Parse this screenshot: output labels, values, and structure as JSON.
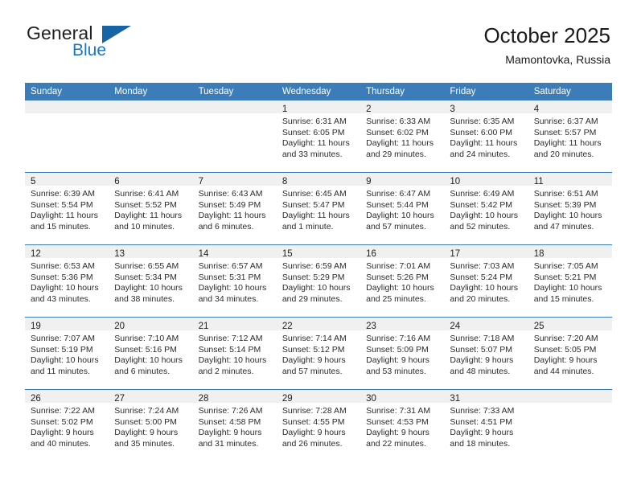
{
  "brand": {
    "name_part1": "General",
    "name_part2": "Blue",
    "flag_icon": "triangle-flag-icon",
    "accent_color": "#1878c8",
    "flag_color": "#1565a6"
  },
  "header": {
    "title": "October 2025",
    "subtitle": "Mamontovka, Russia"
  },
  "theme": {
    "header_row_bg": "#3c7cb8",
    "daynum_bar_bg": "#f0f0f0",
    "grid_line": "#3c7cb8",
    "text": "#2b2b2b"
  },
  "weekday_headers": [
    "Sunday",
    "Monday",
    "Tuesday",
    "Wednesday",
    "Thursday",
    "Friday",
    "Saturday"
  ],
  "weeks": [
    [
      {
        "empty": true,
        "day": "",
        "sunrise": "",
        "sunset": "",
        "daylight_line1": "",
        "daylight_line2": ""
      },
      {
        "empty": true,
        "day": "",
        "sunrise": "",
        "sunset": "",
        "daylight_line1": "",
        "daylight_line2": ""
      },
      {
        "empty": true,
        "day": "",
        "sunrise": "",
        "sunset": "",
        "daylight_line1": "",
        "daylight_line2": ""
      },
      {
        "empty": false,
        "day": "1",
        "sunrise": "Sunrise: 6:31 AM",
        "sunset": "Sunset: 6:05 PM",
        "daylight_line1": "Daylight: 11 hours",
        "daylight_line2": "and 33 minutes."
      },
      {
        "empty": false,
        "day": "2",
        "sunrise": "Sunrise: 6:33 AM",
        "sunset": "Sunset: 6:02 PM",
        "daylight_line1": "Daylight: 11 hours",
        "daylight_line2": "and 29 minutes."
      },
      {
        "empty": false,
        "day": "3",
        "sunrise": "Sunrise: 6:35 AM",
        "sunset": "Sunset: 6:00 PM",
        "daylight_line1": "Daylight: 11 hours",
        "daylight_line2": "and 24 minutes."
      },
      {
        "empty": false,
        "day": "4",
        "sunrise": "Sunrise: 6:37 AM",
        "sunset": "Sunset: 5:57 PM",
        "daylight_line1": "Daylight: 11 hours",
        "daylight_line2": "and 20 minutes."
      }
    ],
    [
      {
        "empty": false,
        "day": "5",
        "sunrise": "Sunrise: 6:39 AM",
        "sunset": "Sunset: 5:54 PM",
        "daylight_line1": "Daylight: 11 hours",
        "daylight_line2": "and 15 minutes."
      },
      {
        "empty": false,
        "day": "6",
        "sunrise": "Sunrise: 6:41 AM",
        "sunset": "Sunset: 5:52 PM",
        "daylight_line1": "Daylight: 11 hours",
        "daylight_line2": "and 10 minutes."
      },
      {
        "empty": false,
        "day": "7",
        "sunrise": "Sunrise: 6:43 AM",
        "sunset": "Sunset: 5:49 PM",
        "daylight_line1": "Daylight: 11 hours",
        "daylight_line2": "and 6 minutes."
      },
      {
        "empty": false,
        "day": "8",
        "sunrise": "Sunrise: 6:45 AM",
        "sunset": "Sunset: 5:47 PM",
        "daylight_line1": "Daylight: 11 hours",
        "daylight_line2": "and 1 minute."
      },
      {
        "empty": false,
        "day": "9",
        "sunrise": "Sunrise: 6:47 AM",
        "sunset": "Sunset: 5:44 PM",
        "daylight_line1": "Daylight: 10 hours",
        "daylight_line2": "and 57 minutes."
      },
      {
        "empty": false,
        "day": "10",
        "sunrise": "Sunrise: 6:49 AM",
        "sunset": "Sunset: 5:42 PM",
        "daylight_line1": "Daylight: 10 hours",
        "daylight_line2": "and 52 minutes."
      },
      {
        "empty": false,
        "day": "11",
        "sunrise": "Sunrise: 6:51 AM",
        "sunset": "Sunset: 5:39 PM",
        "daylight_line1": "Daylight: 10 hours",
        "daylight_line2": "and 47 minutes."
      }
    ],
    [
      {
        "empty": false,
        "day": "12",
        "sunrise": "Sunrise: 6:53 AM",
        "sunset": "Sunset: 5:36 PM",
        "daylight_line1": "Daylight: 10 hours",
        "daylight_line2": "and 43 minutes."
      },
      {
        "empty": false,
        "day": "13",
        "sunrise": "Sunrise: 6:55 AM",
        "sunset": "Sunset: 5:34 PM",
        "daylight_line1": "Daylight: 10 hours",
        "daylight_line2": "and 38 minutes."
      },
      {
        "empty": false,
        "day": "14",
        "sunrise": "Sunrise: 6:57 AM",
        "sunset": "Sunset: 5:31 PM",
        "daylight_line1": "Daylight: 10 hours",
        "daylight_line2": "and 34 minutes."
      },
      {
        "empty": false,
        "day": "15",
        "sunrise": "Sunrise: 6:59 AM",
        "sunset": "Sunset: 5:29 PM",
        "daylight_line1": "Daylight: 10 hours",
        "daylight_line2": "and 29 minutes."
      },
      {
        "empty": false,
        "day": "16",
        "sunrise": "Sunrise: 7:01 AM",
        "sunset": "Sunset: 5:26 PM",
        "daylight_line1": "Daylight: 10 hours",
        "daylight_line2": "and 25 minutes."
      },
      {
        "empty": false,
        "day": "17",
        "sunrise": "Sunrise: 7:03 AM",
        "sunset": "Sunset: 5:24 PM",
        "daylight_line1": "Daylight: 10 hours",
        "daylight_line2": "and 20 minutes."
      },
      {
        "empty": false,
        "day": "18",
        "sunrise": "Sunrise: 7:05 AM",
        "sunset": "Sunset: 5:21 PM",
        "daylight_line1": "Daylight: 10 hours",
        "daylight_line2": "and 15 minutes."
      }
    ],
    [
      {
        "empty": false,
        "day": "19",
        "sunrise": "Sunrise: 7:07 AM",
        "sunset": "Sunset: 5:19 PM",
        "daylight_line1": "Daylight: 10 hours",
        "daylight_line2": "and 11 minutes."
      },
      {
        "empty": false,
        "day": "20",
        "sunrise": "Sunrise: 7:10 AM",
        "sunset": "Sunset: 5:16 PM",
        "daylight_line1": "Daylight: 10 hours",
        "daylight_line2": "and 6 minutes."
      },
      {
        "empty": false,
        "day": "21",
        "sunrise": "Sunrise: 7:12 AM",
        "sunset": "Sunset: 5:14 PM",
        "daylight_line1": "Daylight: 10 hours",
        "daylight_line2": "and 2 minutes."
      },
      {
        "empty": false,
        "day": "22",
        "sunrise": "Sunrise: 7:14 AM",
        "sunset": "Sunset: 5:12 PM",
        "daylight_line1": "Daylight: 9 hours",
        "daylight_line2": "and 57 minutes."
      },
      {
        "empty": false,
        "day": "23",
        "sunrise": "Sunrise: 7:16 AM",
        "sunset": "Sunset: 5:09 PM",
        "daylight_line1": "Daylight: 9 hours",
        "daylight_line2": "and 53 minutes."
      },
      {
        "empty": false,
        "day": "24",
        "sunrise": "Sunrise: 7:18 AM",
        "sunset": "Sunset: 5:07 PM",
        "daylight_line1": "Daylight: 9 hours",
        "daylight_line2": "and 48 minutes."
      },
      {
        "empty": false,
        "day": "25",
        "sunrise": "Sunrise: 7:20 AM",
        "sunset": "Sunset: 5:05 PM",
        "daylight_line1": "Daylight: 9 hours",
        "daylight_line2": "and 44 minutes."
      }
    ],
    [
      {
        "empty": false,
        "day": "26",
        "sunrise": "Sunrise: 7:22 AM",
        "sunset": "Sunset: 5:02 PM",
        "daylight_line1": "Daylight: 9 hours",
        "daylight_line2": "and 40 minutes."
      },
      {
        "empty": false,
        "day": "27",
        "sunrise": "Sunrise: 7:24 AM",
        "sunset": "Sunset: 5:00 PM",
        "daylight_line1": "Daylight: 9 hours",
        "daylight_line2": "and 35 minutes."
      },
      {
        "empty": false,
        "day": "28",
        "sunrise": "Sunrise: 7:26 AM",
        "sunset": "Sunset: 4:58 PM",
        "daylight_line1": "Daylight: 9 hours",
        "daylight_line2": "and 31 minutes."
      },
      {
        "empty": false,
        "day": "29",
        "sunrise": "Sunrise: 7:28 AM",
        "sunset": "Sunset: 4:55 PM",
        "daylight_line1": "Daylight: 9 hours",
        "daylight_line2": "and 26 minutes."
      },
      {
        "empty": false,
        "day": "30",
        "sunrise": "Sunrise: 7:31 AM",
        "sunset": "Sunset: 4:53 PM",
        "daylight_line1": "Daylight: 9 hours",
        "daylight_line2": "and 22 minutes."
      },
      {
        "empty": false,
        "day": "31",
        "sunrise": "Sunrise: 7:33 AM",
        "sunset": "Sunset: 4:51 PM",
        "daylight_line1": "Daylight: 9 hours",
        "daylight_line2": "and 18 minutes."
      },
      {
        "empty": true,
        "day": "",
        "sunrise": "",
        "sunset": "",
        "daylight_line1": "",
        "daylight_line2": ""
      }
    ]
  ]
}
